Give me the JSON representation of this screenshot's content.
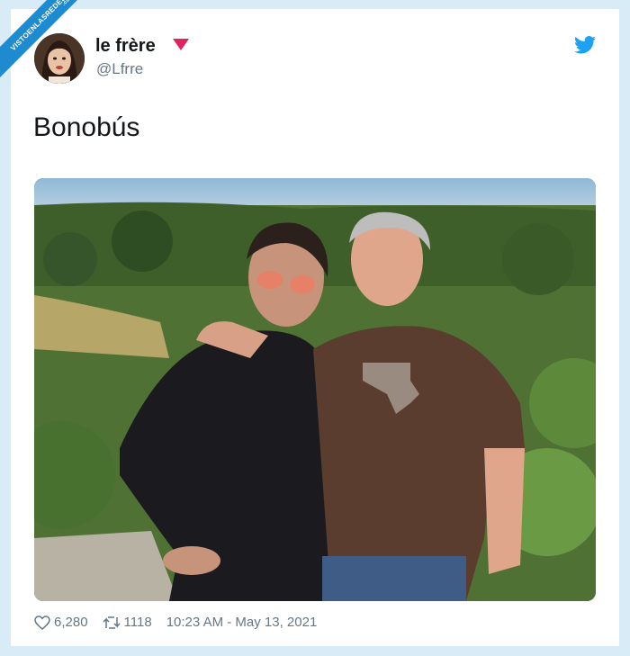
{
  "watermark": {
    "text": "VISTOENLASREDES",
    "sub": ".com"
  },
  "tweet": {
    "display_name": "le frère",
    "handle": "@Lfrre",
    "text": "Bonobús",
    "likes": "6,280",
    "retweets": "1118",
    "timestamp": "10:23 AM - May 13, 2021"
  },
  "icons": {
    "brand": "twitter-bird-icon",
    "like": "heart-icon",
    "retweet": "retweet-icon"
  },
  "colors": {
    "brand": "#1da1f2",
    "background": "#d8ecf7",
    "name_mark": "#e0245e",
    "secondary_text": "#657786"
  }
}
